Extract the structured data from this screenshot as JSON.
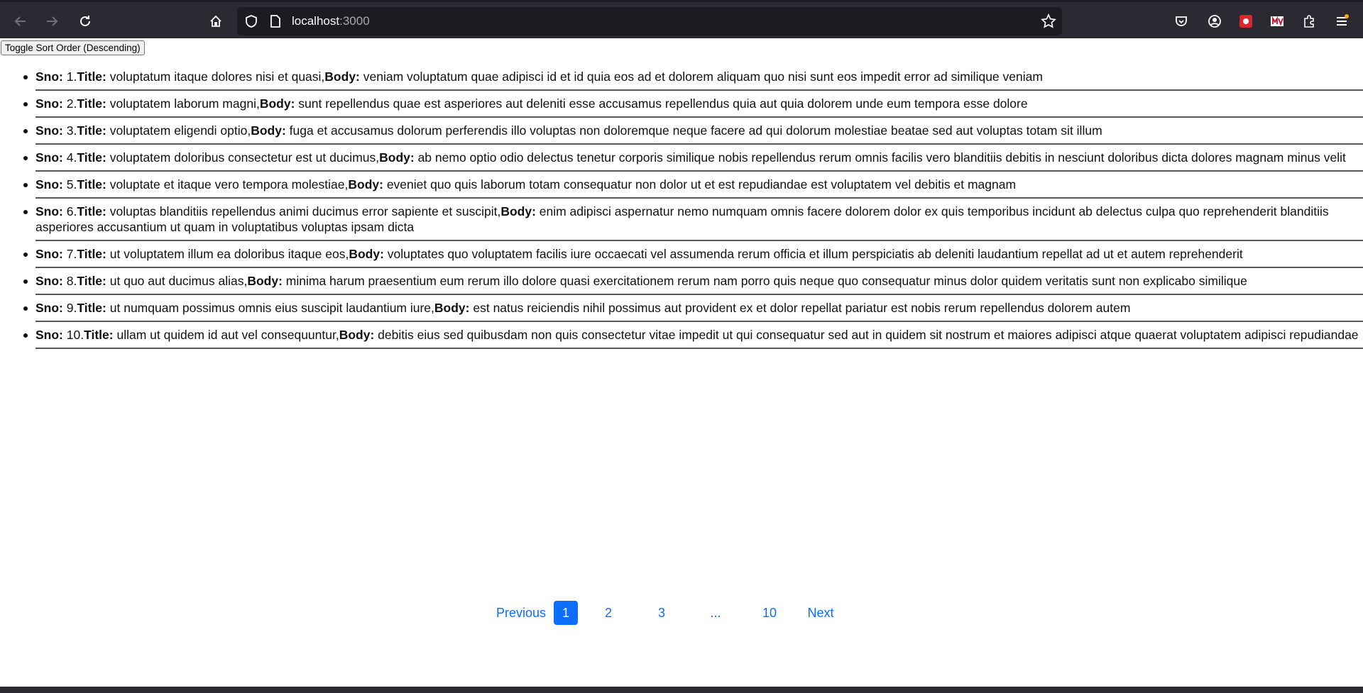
{
  "browser": {
    "url_host": "localhost",
    "url_port": ":3000"
  },
  "page": {
    "sort_button_label": "Toggle Sort Order (Descending)",
    "labels": {
      "sno": "Sno:",
      "title": "Title:",
      "body": "Body:"
    },
    "posts": [
      {
        "sno": "1.",
        "title": "voluptatum itaque dolores nisi et quasi,",
        "body": "veniam voluptatum quae adipisci id et id quia eos ad et dolorem aliquam quo nisi sunt eos impedit error ad similique veniam"
      },
      {
        "sno": "2.",
        "title": "voluptatem laborum magni,",
        "body": "sunt repellendus quae est asperiores aut deleniti esse accusamus repellendus quia aut quia dolorem unde eum tempora esse dolore"
      },
      {
        "sno": "3.",
        "title": "voluptatem eligendi optio,",
        "body": "fuga et accusamus dolorum perferendis illo voluptas non doloremque neque facere ad qui dolorum molestiae beatae sed aut voluptas totam sit illum"
      },
      {
        "sno": "4.",
        "title": "voluptatem doloribus consectetur est ut ducimus,",
        "body": "ab nemo optio odio delectus tenetur corporis similique nobis repellendus rerum omnis facilis vero blanditiis debitis in nesciunt doloribus dicta dolores magnam minus velit"
      },
      {
        "sno": "5.",
        "title": "voluptate et itaque vero tempora molestiae,",
        "body": "eveniet quo quis laborum totam consequatur non dolor ut et est repudiandae est voluptatem vel debitis et magnam"
      },
      {
        "sno": "6.",
        "title": "voluptas blanditiis repellendus animi ducimus error sapiente et suscipit,",
        "body": "enim adipisci aspernatur nemo numquam omnis facere dolorem dolor ex quis temporibus incidunt ab delectus culpa quo reprehenderit blanditiis asperiores accusantium ut quam in voluptatibus voluptas ipsam dicta"
      },
      {
        "sno": "7.",
        "title": "ut voluptatem illum ea doloribus itaque eos,",
        "body": "voluptates quo voluptatem facilis iure occaecati vel assumenda rerum officia et illum perspiciatis ab deleniti laudantium repellat ad ut et autem reprehenderit"
      },
      {
        "sno": "8.",
        "title": "ut quo aut ducimus alias,",
        "body": "minima harum praesentium eum rerum illo dolore quasi exercitationem rerum nam porro quis neque quo consequatur minus dolor quidem veritatis sunt non explicabo similique"
      },
      {
        "sno": "9.",
        "title": "ut numquam possimus omnis eius suscipit laudantium iure,",
        "body": "est natus reiciendis nihil possimus aut provident ex et dolor repellat pariatur est nobis rerum repellendus dolorem autem"
      },
      {
        "sno": "10.",
        "title": "ullam ut quidem id aut vel consequuntur,",
        "body": "debitis eius sed quibusdam non quis consectetur vitae impedit ut qui consequatur sed aut in quidem sit nostrum et maiores adipisci atque quaerat voluptatem adipisci repudiandae"
      }
    ],
    "pagination": {
      "previous": "Previous",
      "pages": [
        "1",
        "2",
        "3",
        "...",
        "10"
      ],
      "active_page": "1",
      "next": "Next"
    }
  },
  "colors": {
    "accent": "#0d6efd",
    "chrome_bg": "#2b2a33",
    "urlbar_bg": "#1c1b22"
  }
}
